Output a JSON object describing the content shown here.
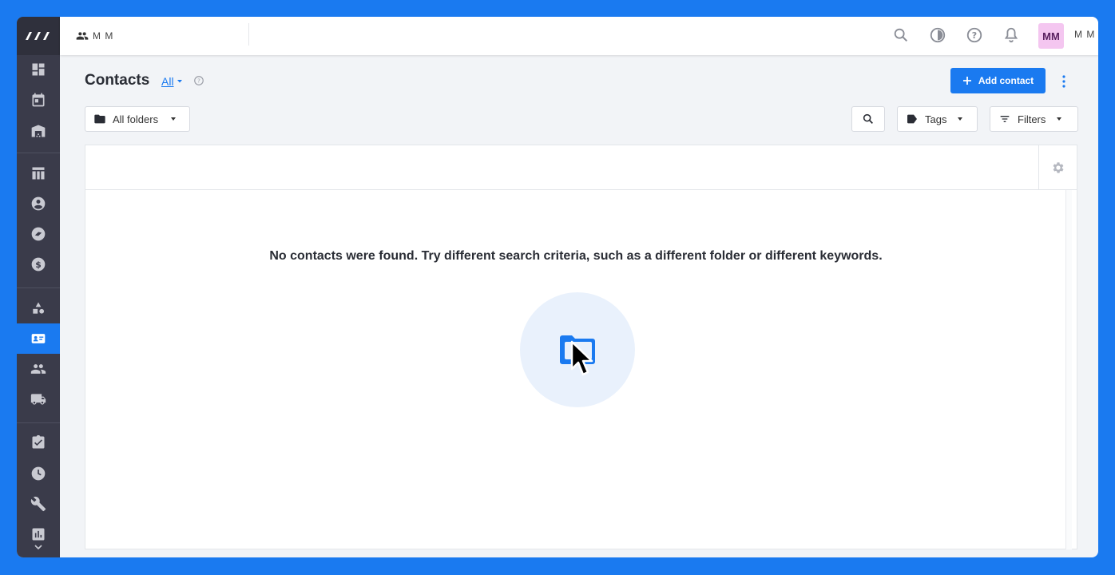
{
  "header": {
    "workspace_name": "M M",
    "avatar_initials": "MM",
    "user_name": "M M",
    "icons": [
      "search-icon",
      "theme-icon",
      "help-icon",
      "bell-icon"
    ]
  },
  "sidebar": {
    "items": [
      {
        "name": "dashboard",
        "icon": "dashboard-icon"
      },
      {
        "name": "calendar",
        "icon": "calendar-icon"
      },
      {
        "name": "warehouse",
        "icon": "warehouse-icon"
      },
      {
        "name": "table",
        "icon": "table-icon"
      },
      {
        "name": "account",
        "icon": "account-circle-icon"
      },
      {
        "name": "compass",
        "icon": "compass-icon"
      },
      {
        "name": "billing",
        "icon": "dollar-icon"
      },
      {
        "name": "shapes",
        "icon": "shapes-icon"
      },
      {
        "name": "contacts",
        "icon": "contact-card-icon",
        "active": true
      },
      {
        "name": "people",
        "icon": "people-icon"
      },
      {
        "name": "shipping",
        "icon": "truck-icon"
      },
      {
        "name": "tasks",
        "icon": "clipboard-check-icon"
      },
      {
        "name": "time",
        "icon": "clock-icon"
      },
      {
        "name": "tools",
        "icon": "wrench-icon"
      },
      {
        "name": "reports",
        "icon": "chart-icon"
      }
    ]
  },
  "page": {
    "title": "Contacts",
    "view_filter": "All",
    "add_button_label": "Add contact"
  },
  "toolbar": {
    "folder_label": "All folders",
    "tags_label": "Tags",
    "filters_label": "Filters"
  },
  "empty_state": {
    "message": "No contacts were found. Try different search criteria, such as a different folder or different keywords."
  },
  "colors": {
    "accent": "#1a7af0",
    "sidebar": "#3a3b4a",
    "avatar_bg": "#f4c6f0"
  }
}
